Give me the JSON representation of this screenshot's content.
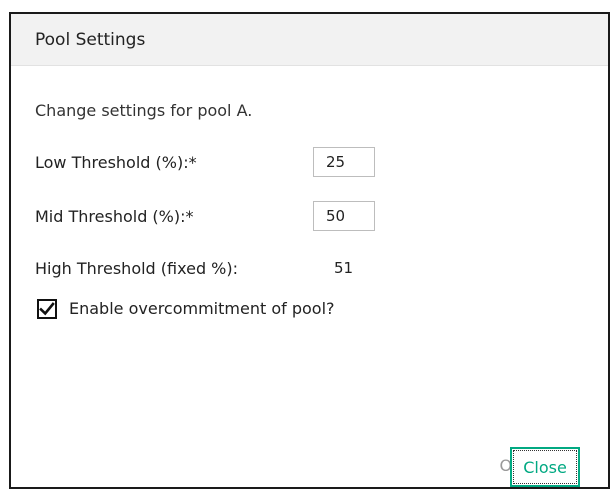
{
  "dialog": {
    "title": "Pool Settings",
    "description": "Change settings for pool A.",
    "low_threshold": {
      "label": "Low Threshold (%):*",
      "value": "25"
    },
    "mid_threshold": {
      "label": "Mid Threshold (%):*",
      "value": "50"
    },
    "high_threshold": {
      "label": "High Threshold (fixed %):",
      "value": "51"
    },
    "overcommit": {
      "label": "Enable overcommitment of pool?",
      "checked": true
    },
    "buttons": {
      "ok_label": "OK",
      "close_label": "Close"
    }
  },
  "colors": {
    "accent": "#01a982",
    "disabled_text": "#9a9a9a",
    "titlebar_bg": "#f2f2f2",
    "border": "#1a1a1a"
  },
  "icons": {
    "checkbox_mark": "checkmark-icon"
  }
}
